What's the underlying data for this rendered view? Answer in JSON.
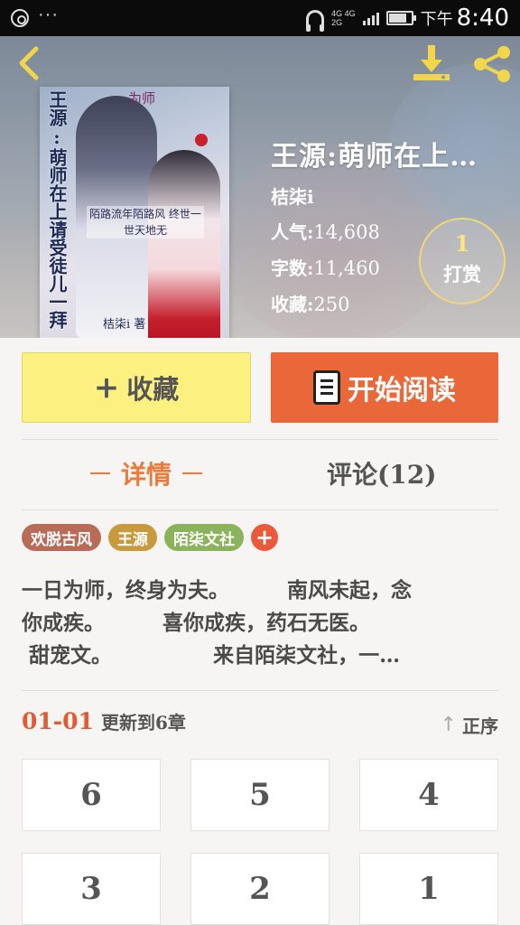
{
  "status_bar": {
    "network_top": "4G 4G",
    "network_bottom": "2G",
    "ampm": "下午",
    "time": "8:40",
    "battery_level": 0.8
  },
  "book": {
    "title": "王源:萌师在上…",
    "author": "桔柒i",
    "cover": {
      "vertical_title": "王源:萌师在上请受徒儿一拜",
      "tag": "为师",
      "motto": "陌路流年陌路风 终世一世天地无",
      "author": "桔柒i 著"
    },
    "stats": [
      {
        "label": "人气:",
        "value": "14,608"
      },
      {
        "label": "字数:",
        "value": "11,460"
      },
      {
        "label": "收藏:",
        "value": "250"
      }
    ],
    "reward": {
      "count": "1",
      "label": "打赏"
    }
  },
  "actions": {
    "favorite": {
      "icon": "+",
      "label": "收藏"
    },
    "read": {
      "label": "开始阅读"
    }
  },
  "tabs": [
    {
      "label": "详情",
      "active": true
    },
    {
      "label": "评论(12)",
      "active": false
    }
  ],
  "tags": [
    {
      "label": "欢脱古风",
      "color": "#b86b57"
    },
    {
      "label": "王源",
      "color": "#c99a3d"
    },
    {
      "label": "陌柒文社",
      "color": "#8ab35b"
    }
  ],
  "tag_add": "+",
  "description": {
    "line1": "一日为师，终身为夫。        南风未起，念",
    "line2": "你成疾。        喜你成疾，药石无医。",
    "line3": " 甜宠文。              来自陌柒文社，一…"
  },
  "update": {
    "date": "01-01",
    "text": "更新到6章"
  },
  "order": {
    "label": "正序"
  },
  "chapters": [
    "6",
    "5",
    "4",
    "3",
    "2",
    "1"
  ],
  "colors": {
    "accent_orange": "#ea6739",
    "favorite_yellow": "#fcf080",
    "tab_active": "#ec7b3b",
    "download_icon": "#f1d64b",
    "share_icon": "#f1d64b"
  }
}
